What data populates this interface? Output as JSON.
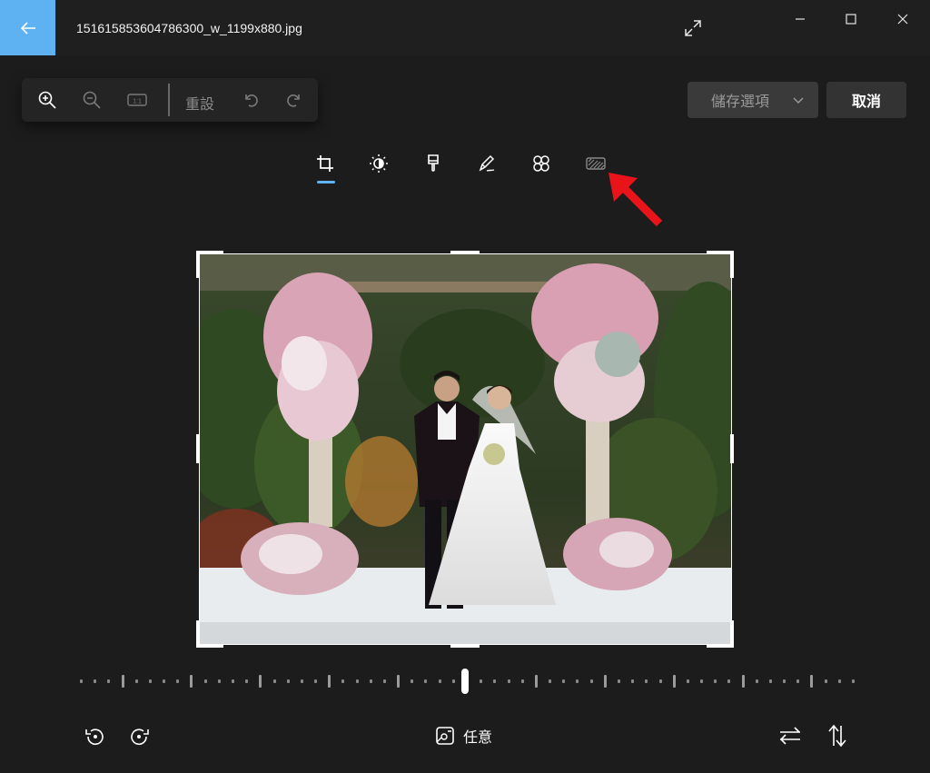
{
  "window": {
    "filename": "151615853604786300_w_1199x880.jpg"
  },
  "toolbar": {
    "zoom_in_icon": "zoom-in-icon",
    "zoom_out_icon": "zoom-out-icon",
    "actual_size_icon": "1:1",
    "reset_label": "重設",
    "undo_icon": "undo-icon",
    "redo_icon": "redo-icon"
  },
  "actions": {
    "save_options_label": "儲存選項",
    "cancel_label": "取消"
  },
  "edit_tabs": [
    {
      "name": "crop",
      "icon": "crop-icon",
      "selected": true
    },
    {
      "name": "adjust",
      "icon": "brightness-icon",
      "selected": false
    },
    {
      "name": "filter",
      "icon": "brush-icon",
      "selected": false
    },
    {
      "name": "markup",
      "icon": "pen-icon",
      "selected": false
    },
    {
      "name": "retouch",
      "icon": "spot-fix-icon",
      "selected": false
    },
    {
      "name": "background",
      "icon": "background-blur-icon",
      "selected": false
    }
  ],
  "bottom_bar": {
    "aspect_label": "任意",
    "rotate_left_icon": "rotate-left-icon",
    "rotate_right_icon": "rotate-right-icon",
    "flip_horizontal_icon": "flip-horizontal-icon",
    "flip_vertical_icon": "flip-vertical-icon"
  },
  "straighten_slider": {
    "value": 0
  },
  "colors": {
    "accent": "#5fb2f2",
    "background": "#1c1c1c",
    "annotation_arrow": "#e8141a"
  }
}
